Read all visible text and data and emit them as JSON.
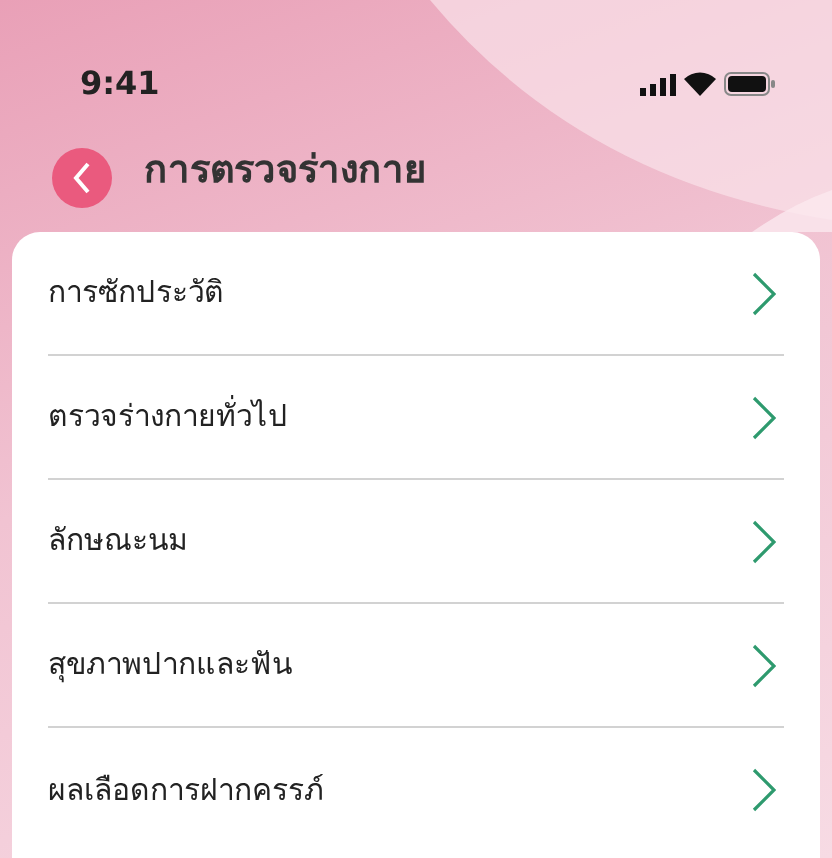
{
  "status_bar": {
    "time": "9:41"
  },
  "header": {
    "title": "การตรวจร่างกาย"
  },
  "menu_items": [
    {
      "label": "การซักประวัติ"
    },
    {
      "label": "ตรวจร่างกายทั่วไป"
    },
    {
      "label": "ลักษณะนม"
    },
    {
      "label": "สุขภาพปากและฟัน"
    },
    {
      "label": "ผลเลือดการฝากครรภ์"
    }
  ]
}
